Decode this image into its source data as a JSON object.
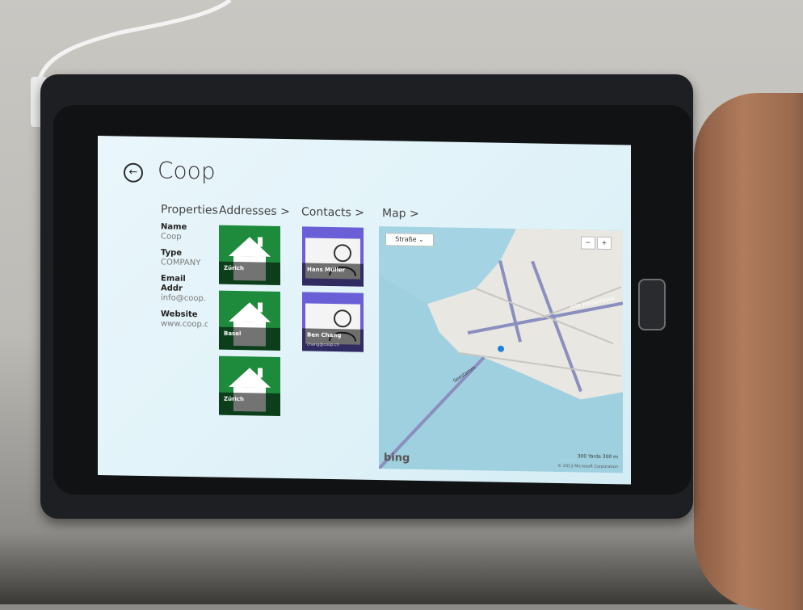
{
  "page": {
    "title": "Coop",
    "back_icon": "arrow-left-icon"
  },
  "columns": {
    "properties": "Properties",
    "addresses": "Addresses >",
    "contacts": "Contacts >",
    "map": "Map >"
  },
  "properties": [
    {
      "label": "Name",
      "value": "Coop"
    },
    {
      "label": "Type",
      "value": "COMPANY"
    },
    {
      "label": "Email Addr",
      "value": "info@coop."
    },
    {
      "label": "Website",
      "value": "www.coop.c"
    }
  ],
  "addresses": [
    {
      "label": "Zürich"
    },
    {
      "label": "Basel"
    },
    {
      "label": "Zürich"
    }
  ],
  "contacts": [
    {
      "label": "Hans Müller",
      "sub": ""
    },
    {
      "label": "Ben Chang",
      "sub": "chang@coop.ch"
    }
  ],
  "map": {
    "style_select": "Straße",
    "zoom_out": "−",
    "zoom_in": "+",
    "brand": "bing",
    "scale": "300 Yards   300 m",
    "copyright": "© 2013 Microsoft Corporation",
    "street_labels": [
      "Seestamm",
      "Alte Jonastrasse"
    ]
  },
  "colors": {
    "address_tile": "#1e8a3c",
    "contact_tile": "#6a5fd6"
  }
}
